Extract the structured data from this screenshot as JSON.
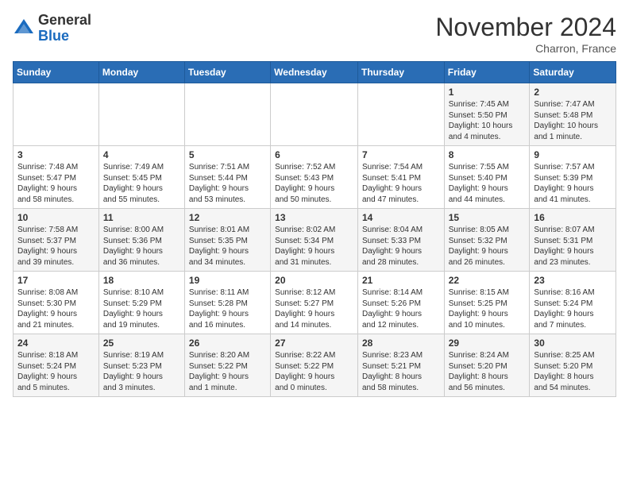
{
  "logo": {
    "general": "General",
    "blue": "Blue"
  },
  "header": {
    "month": "November 2024",
    "location": "Charron, France"
  },
  "weekdays": [
    "Sunday",
    "Monday",
    "Tuesday",
    "Wednesday",
    "Thursday",
    "Friday",
    "Saturday"
  ],
  "weeks": [
    [
      {
        "day": "",
        "info": ""
      },
      {
        "day": "",
        "info": ""
      },
      {
        "day": "",
        "info": ""
      },
      {
        "day": "",
        "info": ""
      },
      {
        "day": "",
        "info": ""
      },
      {
        "day": "1",
        "info": "Sunrise: 7:45 AM\nSunset: 5:50 PM\nDaylight: 10 hours\nand 4 minutes."
      },
      {
        "day": "2",
        "info": "Sunrise: 7:47 AM\nSunset: 5:48 PM\nDaylight: 10 hours\nand 1 minute."
      }
    ],
    [
      {
        "day": "3",
        "info": "Sunrise: 7:48 AM\nSunset: 5:47 PM\nDaylight: 9 hours\nand 58 minutes."
      },
      {
        "day": "4",
        "info": "Sunrise: 7:49 AM\nSunset: 5:45 PM\nDaylight: 9 hours\nand 55 minutes."
      },
      {
        "day": "5",
        "info": "Sunrise: 7:51 AM\nSunset: 5:44 PM\nDaylight: 9 hours\nand 53 minutes."
      },
      {
        "day": "6",
        "info": "Sunrise: 7:52 AM\nSunset: 5:43 PM\nDaylight: 9 hours\nand 50 minutes."
      },
      {
        "day": "7",
        "info": "Sunrise: 7:54 AM\nSunset: 5:41 PM\nDaylight: 9 hours\nand 47 minutes."
      },
      {
        "day": "8",
        "info": "Sunrise: 7:55 AM\nSunset: 5:40 PM\nDaylight: 9 hours\nand 44 minutes."
      },
      {
        "day": "9",
        "info": "Sunrise: 7:57 AM\nSunset: 5:39 PM\nDaylight: 9 hours\nand 41 minutes."
      }
    ],
    [
      {
        "day": "10",
        "info": "Sunrise: 7:58 AM\nSunset: 5:37 PM\nDaylight: 9 hours\nand 39 minutes."
      },
      {
        "day": "11",
        "info": "Sunrise: 8:00 AM\nSunset: 5:36 PM\nDaylight: 9 hours\nand 36 minutes."
      },
      {
        "day": "12",
        "info": "Sunrise: 8:01 AM\nSunset: 5:35 PM\nDaylight: 9 hours\nand 34 minutes."
      },
      {
        "day": "13",
        "info": "Sunrise: 8:02 AM\nSunset: 5:34 PM\nDaylight: 9 hours\nand 31 minutes."
      },
      {
        "day": "14",
        "info": "Sunrise: 8:04 AM\nSunset: 5:33 PM\nDaylight: 9 hours\nand 28 minutes."
      },
      {
        "day": "15",
        "info": "Sunrise: 8:05 AM\nSunset: 5:32 PM\nDaylight: 9 hours\nand 26 minutes."
      },
      {
        "day": "16",
        "info": "Sunrise: 8:07 AM\nSunset: 5:31 PM\nDaylight: 9 hours\nand 23 minutes."
      }
    ],
    [
      {
        "day": "17",
        "info": "Sunrise: 8:08 AM\nSunset: 5:30 PM\nDaylight: 9 hours\nand 21 minutes."
      },
      {
        "day": "18",
        "info": "Sunrise: 8:10 AM\nSunset: 5:29 PM\nDaylight: 9 hours\nand 19 minutes."
      },
      {
        "day": "19",
        "info": "Sunrise: 8:11 AM\nSunset: 5:28 PM\nDaylight: 9 hours\nand 16 minutes."
      },
      {
        "day": "20",
        "info": "Sunrise: 8:12 AM\nSunset: 5:27 PM\nDaylight: 9 hours\nand 14 minutes."
      },
      {
        "day": "21",
        "info": "Sunrise: 8:14 AM\nSunset: 5:26 PM\nDaylight: 9 hours\nand 12 minutes."
      },
      {
        "day": "22",
        "info": "Sunrise: 8:15 AM\nSunset: 5:25 PM\nDaylight: 9 hours\nand 10 minutes."
      },
      {
        "day": "23",
        "info": "Sunrise: 8:16 AM\nSunset: 5:24 PM\nDaylight: 9 hours\nand 7 minutes."
      }
    ],
    [
      {
        "day": "24",
        "info": "Sunrise: 8:18 AM\nSunset: 5:24 PM\nDaylight: 9 hours\nand 5 minutes."
      },
      {
        "day": "25",
        "info": "Sunrise: 8:19 AM\nSunset: 5:23 PM\nDaylight: 9 hours\nand 3 minutes."
      },
      {
        "day": "26",
        "info": "Sunrise: 8:20 AM\nSunset: 5:22 PM\nDaylight: 9 hours\nand 1 minute."
      },
      {
        "day": "27",
        "info": "Sunrise: 8:22 AM\nSunset: 5:22 PM\nDaylight: 9 hours\nand 0 minutes."
      },
      {
        "day": "28",
        "info": "Sunrise: 8:23 AM\nSunset: 5:21 PM\nDaylight: 8 hours\nand 58 minutes."
      },
      {
        "day": "29",
        "info": "Sunrise: 8:24 AM\nSunset: 5:20 PM\nDaylight: 8 hours\nand 56 minutes."
      },
      {
        "day": "30",
        "info": "Sunrise: 8:25 AM\nSunset: 5:20 PM\nDaylight: 8 hours\nand 54 minutes."
      }
    ]
  ]
}
